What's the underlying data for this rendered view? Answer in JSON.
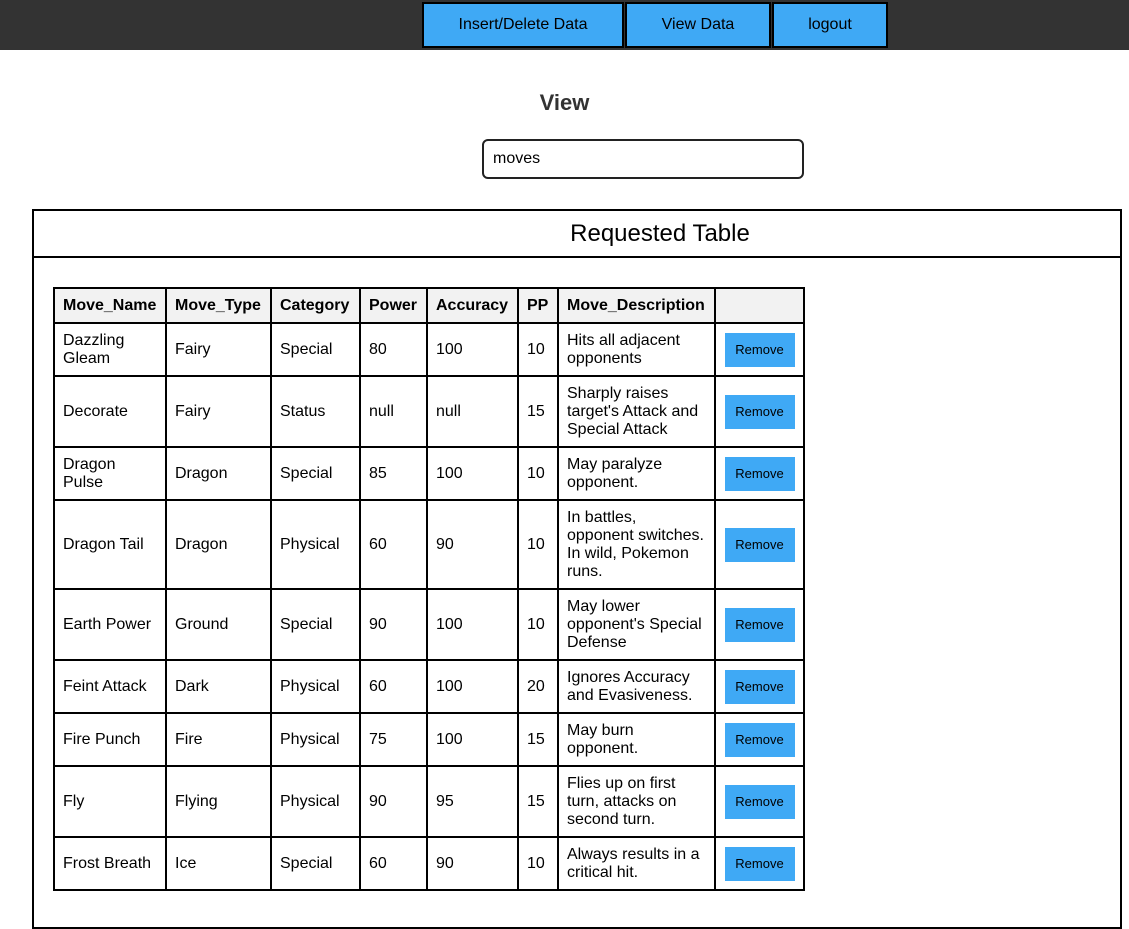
{
  "nav": {
    "insert_label": "Insert/Delete Data",
    "view_label": "View Data",
    "logout_label": "logout"
  },
  "page": {
    "title": "View",
    "search_value": "moves"
  },
  "panel": {
    "title": "Requested Table"
  },
  "table": {
    "columns": [
      "Move_Name",
      "Move_Type",
      "Category",
      "Power",
      "Accuracy",
      "PP",
      "Move_Description",
      ""
    ],
    "remove_label": "Remove",
    "rows": [
      {
        "name": "Dazzling Gleam",
        "type": "Fairy",
        "category": "Special",
        "power": "80",
        "accuracy": "100",
        "pp": "10",
        "description": "Hits all adjacent opponents"
      },
      {
        "name": "Decorate",
        "type": "Fairy",
        "category": "Status",
        "power": "null",
        "accuracy": "null",
        "pp": "15",
        "description": "Sharply raises target's Attack and Special Attack"
      },
      {
        "name": "Dragon Pulse",
        "type": "Dragon",
        "category": "Special",
        "power": "85",
        "accuracy": "100",
        "pp": "10",
        "description": "May paralyze opponent."
      },
      {
        "name": "Dragon Tail",
        "type": "Dragon",
        "category": "Physical",
        "power": "60",
        "accuracy": "90",
        "pp": "10",
        "description": "In battles, opponent switches. In wild, Pokemon runs."
      },
      {
        "name": "Earth Power",
        "type": "Ground",
        "category": "Special",
        "power": "90",
        "accuracy": "100",
        "pp": "10",
        "description": "May lower opponent's Special Defense"
      },
      {
        "name": "Feint Attack",
        "type": "Dark",
        "category": "Physical",
        "power": "60",
        "accuracy": "100",
        "pp": "20",
        "description": "Ignores Accuracy and Evasiveness."
      },
      {
        "name": "Fire Punch",
        "type": "Fire",
        "category": "Physical",
        "power": "75",
        "accuracy": "100",
        "pp": "15",
        "description": "May burn opponent."
      },
      {
        "name": "Fly",
        "type": "Flying",
        "category": "Physical",
        "power": "90",
        "accuracy": "95",
        "pp": "15",
        "description": "Flies up on first turn, attacks on second turn."
      },
      {
        "name": "Frost Breath",
        "type": "Ice",
        "category": "Special",
        "power": "60",
        "accuracy": "90",
        "pp": "10",
        "description": "Always results in a critical hit."
      }
    ]
  },
  "colors": {
    "topbar": "#333333",
    "accent": "#3fa9f5"
  }
}
